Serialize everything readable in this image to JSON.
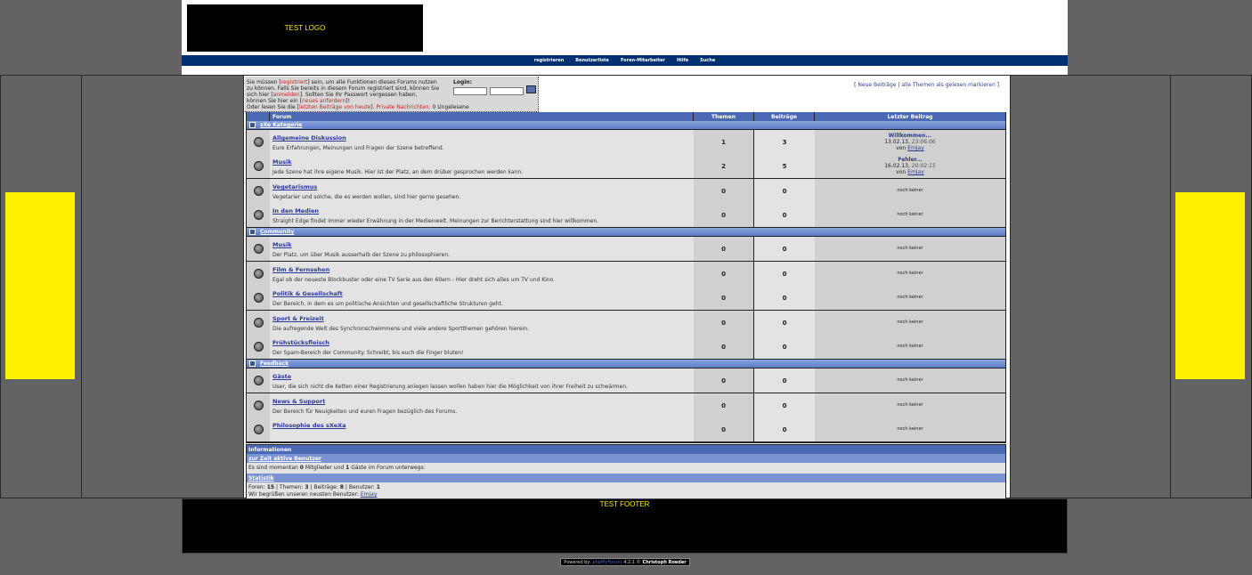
{
  "header": {
    "logo_text": "TEST LOGO",
    "nav": [
      "registrieren",
      "Benutzerliste",
      "Foren-Mitarbeiter",
      "Hilfe",
      "Suche"
    ]
  },
  "login": {
    "text1a": "Sie müssen [",
    "text1link": "registriert",
    "text1b": "] sein, um alle Funktionen dieses Forums nutzen",
    "text2": "zu können. Falls Sie bereits in diesem Forum registriert sind, können Sie",
    "text3a": "sich hier [",
    "text3link": "anmelden",
    "text3b": "]. Sollten Sie Ihr Passwort vergessen haben,",
    "text4a": "können Sie hier ein [",
    "text4link": "neues anfordern",
    "text4b": "]!",
    "text5a": "Oder lesen Sie die [",
    "text5link": "letzten Beiträge von heute",
    "text5b": "].",
    "pm_label": "Private Nachrichten:",
    "pm_value": "0 Ungelesene",
    "label": "Login:"
  },
  "quicklinks": {
    "new_posts": "Neue Beiträge",
    "mark_read": "alle Themen als gelesen markieren"
  },
  "table_headers": {
    "forum": "Forum",
    "themen": "Themen",
    "beitraege": "Beiträge",
    "letzter": "Letzter Beitrag"
  },
  "categories": [
    {
      "title": "sXe Kategorie",
      "groups": [
        [
          {
            "name": "Allgemeine Diskussion",
            "desc": "Eure Erfahrungen, Meinungen und Fragen der Szene betreffend.",
            "themen": "1",
            "beitraege": "3",
            "last_title": "Willkommen...",
            "last_date": "13.02.13,",
            "last_time": "23:06:06",
            "last_by_label": "von",
            "last_by": "EmJay"
          },
          {
            "name": "Musik",
            "desc": "Jede Szene hat ihre eigene Musik. Hier ist der Platz, an dem drüber gesprochen werden kann.",
            "themen": "2",
            "beitraege": "5",
            "last_title": "Fehler...",
            "last_date": "16.02.13,",
            "last_time": "20:02:15",
            "last_by_label": "von",
            "last_by": "EmJay"
          }
        ],
        [
          {
            "name": "Vegetarismus",
            "desc": "Vegetarier und solche, die es werden wollen, sind hier gerne gesehen.",
            "themen": "0",
            "beitraege": "0",
            "none": "noch keiner"
          },
          {
            "name": "In den Medien",
            "desc": "Straight Edge findet immer wieder Erwähnung in der Medienwelt. Meinungen zur Berichterstattung sind hier willkommen.",
            "themen": "0",
            "beitraege": "0",
            "none": "noch keiner"
          }
        ]
      ]
    },
    {
      "title": "Community",
      "groups": [
        [
          {
            "name": "Musik",
            "desc": "Der Platz, um über Musik ausserhalb der Szene zu philosophieren.",
            "themen": "0",
            "beitraege": "0",
            "none": "noch keiner"
          }
        ],
        [
          {
            "name": "Film & Fernsehen",
            "desc": "Egal ob der neueste Blockbuster oder eine TV Serie aus den 60ern - Hier dreht sich alles um TV und Kino.",
            "themen": "0",
            "beitraege": "0",
            "none": "noch keiner"
          },
          {
            "name": "Politik & Gesellschaft",
            "desc": "Der Bereich, in dem es um politische Ansichten und gesellschaftliche Strukturen geht.",
            "themen": "0",
            "beitraege": "0",
            "none": "noch keiner"
          }
        ],
        [
          {
            "name": "Sport & Freizeit",
            "desc": "Die aufregende Welt des Synchronschwimmens und viele andere Sportthemen gehören hierein.",
            "themen": "0",
            "beitraege": "0",
            "none": "noch keiner"
          },
          {
            "name": "Frühstücksfleisch",
            "desc": "Der Spam-Bereich der Community. Schreibt, bis euch die Finger bluten!",
            "themen": "0",
            "beitraege": "0",
            "none": "noch keiner"
          }
        ]
      ]
    },
    {
      "title": "Feedback",
      "groups": [
        [
          {
            "name": "Gäste",
            "desc": "User, die sich nicht die Ketten einer Registrierung anlegen lassen wollen haben hier die Möglichkeit von ihrer Freiheit zu schwärmen.",
            "themen": "0",
            "beitraege": "0",
            "none": "noch keiner"
          }
        ],
        [
          {
            "name": "News & Support",
            "desc": "Der Bereich für Neuigkeiten und euren Fragen bezüglich des Forums.",
            "themen": "0",
            "beitraege": "0",
            "none": "noch keiner"
          },
          {
            "name": "Philosophie des sXeXa",
            "desc": "",
            "themen": "0",
            "beitraege": "0",
            "none": "noch keiner"
          }
        ]
      ]
    }
  ],
  "info": {
    "title": "Informationen",
    "active_title": "zur Zeit aktive Benutzer",
    "active_text_a": "Es sind momentan",
    "active_members": "0",
    "active_text_b": "Mitglieder und",
    "active_guests": "1",
    "active_text_c": "Gäste im Forum unterwegs:",
    "stats_title": "Statistik",
    "foren_label": "Foren:",
    "foren": "15",
    "themen_label": "Themen:",
    "themen": "3",
    "beitraege_label": "Beiträge:",
    "beitraege": "8",
    "benutzer_label": "Benutzer:",
    "benutzer": "1",
    "welcome_text": "Wir begrüßen unseren neusten Benutzer:",
    "newest_user": "EmJay"
  },
  "footer": {
    "text": "TEST FOOTER",
    "powered_label": "Powered by:",
    "powered_product": "phpMyForum",
    "powered_version": "4.2.1 ©",
    "powered_author": "Christoph Roeder"
  }
}
